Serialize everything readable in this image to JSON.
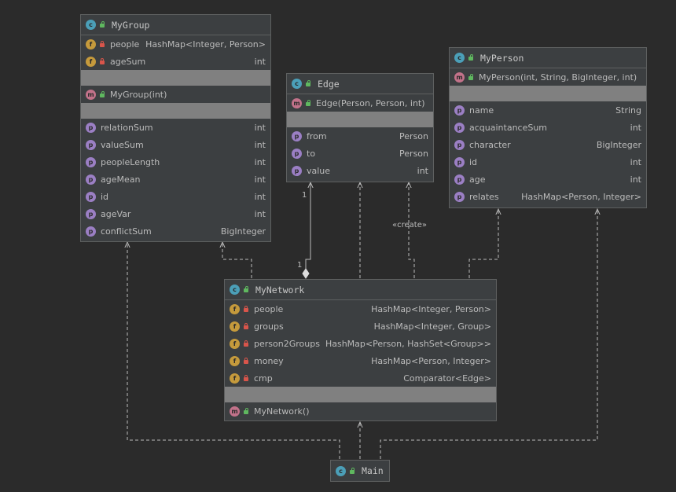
{
  "colors": {
    "background": "#2b2b2b",
    "box_fill": "#3c3f41",
    "edge": "#bbbbbb",
    "class_badge": "#4b9fb8",
    "field_badge": "#c59a3c",
    "method_badge": "#c2728a",
    "property_badge": "#9b7fc4"
  },
  "classes": {
    "mygroup": {
      "title": "MyGroup",
      "fields": [
        {
          "name": "people",
          "type": "HashMap<Integer, Person>",
          "icon": "f",
          "vis": "private"
        },
        {
          "name": "ageSum",
          "type": "int",
          "icon": "f",
          "vis": "private"
        }
      ],
      "methods": [
        {
          "name": "MyGroup(int)",
          "type": "",
          "icon": "m",
          "vis": "public"
        }
      ],
      "properties": [
        {
          "name": "relationSum",
          "type": "int",
          "icon": "p",
          "vis": "none"
        },
        {
          "name": "valueSum",
          "type": "int",
          "icon": "p",
          "vis": "none"
        },
        {
          "name": "peopleLength",
          "type": "int",
          "icon": "p",
          "vis": "none"
        },
        {
          "name": "ageMean",
          "type": "int",
          "icon": "p",
          "vis": "none"
        },
        {
          "name": "id",
          "type": "int",
          "icon": "p",
          "vis": "none"
        },
        {
          "name": "ageVar",
          "type": "int",
          "icon": "p",
          "vis": "none"
        },
        {
          "name": "conflictSum",
          "type": "BigInteger",
          "icon": "p",
          "vis": "none"
        }
      ]
    },
    "edge": {
      "title": "Edge",
      "fields": [],
      "methods": [
        {
          "name": "Edge(Person, Person, int)",
          "type": "",
          "icon": "m",
          "vis": "public"
        }
      ],
      "properties": [
        {
          "name": "from",
          "type": "Person",
          "icon": "p",
          "vis": "none"
        },
        {
          "name": "to",
          "type": "Person",
          "icon": "p",
          "vis": "none"
        },
        {
          "name": "value",
          "type": "int",
          "icon": "p",
          "vis": "none"
        }
      ]
    },
    "myperson": {
      "title": "MyPerson",
      "fields": [],
      "methods": [
        {
          "name": "MyPerson(int, String, BigInteger, int)",
          "type": "",
          "icon": "m",
          "vis": "public"
        }
      ],
      "properties": [
        {
          "name": "name",
          "type": "String",
          "icon": "p",
          "vis": "none"
        },
        {
          "name": "acquaintanceSum",
          "type": "int",
          "icon": "p",
          "vis": "none"
        },
        {
          "name": "character",
          "type": "BigInteger",
          "icon": "p",
          "vis": "none"
        },
        {
          "name": "id",
          "type": "int",
          "icon": "p",
          "vis": "none"
        },
        {
          "name": "age",
          "type": "int",
          "icon": "p",
          "vis": "none"
        },
        {
          "name": "relates",
          "type": "HashMap<Person, Integer>",
          "icon": "p",
          "vis": "none"
        }
      ]
    },
    "mynetwork": {
      "title": "MyNetwork",
      "fields": [
        {
          "name": "people",
          "type": "HashMap<Integer, Person>",
          "icon": "f",
          "vis": "private"
        },
        {
          "name": "groups",
          "type": "HashMap<Integer, Group>",
          "icon": "f",
          "vis": "private"
        },
        {
          "name": "person2Groups",
          "type": "HashMap<Person, HashSet<Group>>",
          "icon": "f",
          "vis": "private"
        },
        {
          "name": "money",
          "type": "HashMap<Person, Integer>",
          "icon": "f",
          "vis": "private"
        },
        {
          "name": "cmp",
          "type": "Comparator<Edge>",
          "icon": "f",
          "vis": "private"
        }
      ],
      "methods": [
        {
          "name": "MyNetwork()",
          "type": "",
          "icon": "m",
          "vis": "public"
        }
      ],
      "properties": []
    },
    "main": {
      "title": "Main"
    }
  },
  "labels": {
    "multiplicity_top": "1",
    "multiplicity_bottom": "1",
    "create_stereotype": "«create»"
  }
}
